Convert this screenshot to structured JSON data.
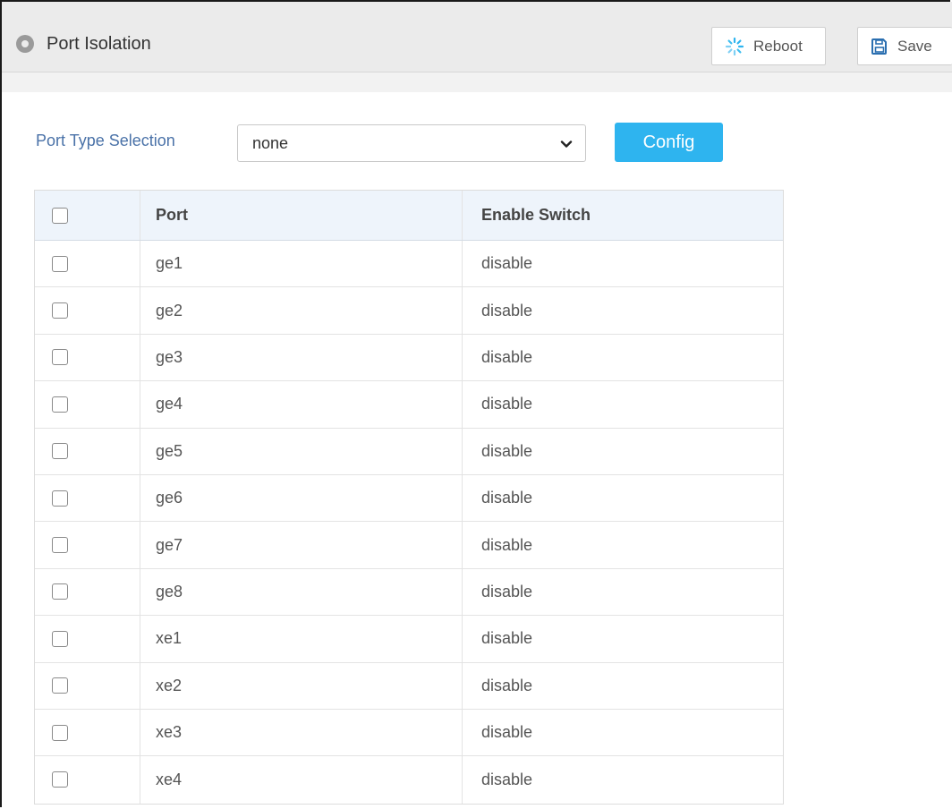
{
  "header": {
    "title": "Port Isolation",
    "reboot_label": "Reboot",
    "save_label": "Save"
  },
  "form": {
    "port_type_label": "Port Type Selection",
    "port_type_value": "none",
    "config_label": "Config"
  },
  "table": {
    "columns": [
      "Port",
      "Enable Switch"
    ],
    "rows": [
      {
        "port": "ge1",
        "enable": "disable"
      },
      {
        "port": "ge2",
        "enable": "disable"
      },
      {
        "port": "ge3",
        "enable": "disable"
      },
      {
        "port": "ge4",
        "enable": "disable"
      },
      {
        "port": "ge5",
        "enable": "disable"
      },
      {
        "port": "ge6",
        "enable": "disable"
      },
      {
        "port": "ge7",
        "enable": "disable"
      },
      {
        "port": "ge8",
        "enable": "disable"
      },
      {
        "port": "xe1",
        "enable": "disable"
      },
      {
        "port": "xe2",
        "enable": "disable"
      },
      {
        "port": "xe3",
        "enable": "disable"
      },
      {
        "port": "xe4",
        "enable": "disable"
      }
    ]
  },
  "colors": {
    "accent": "#2eb4ef",
    "label_blue": "#4a72a8",
    "header_bg": "#ebebeb",
    "table_head_bg": "#eef4fb"
  },
  "icons": {
    "title": "location-dot-icon",
    "reboot": "spinner-icon",
    "save": "floppy-disk-icon",
    "select": "chevron-down-icon"
  }
}
